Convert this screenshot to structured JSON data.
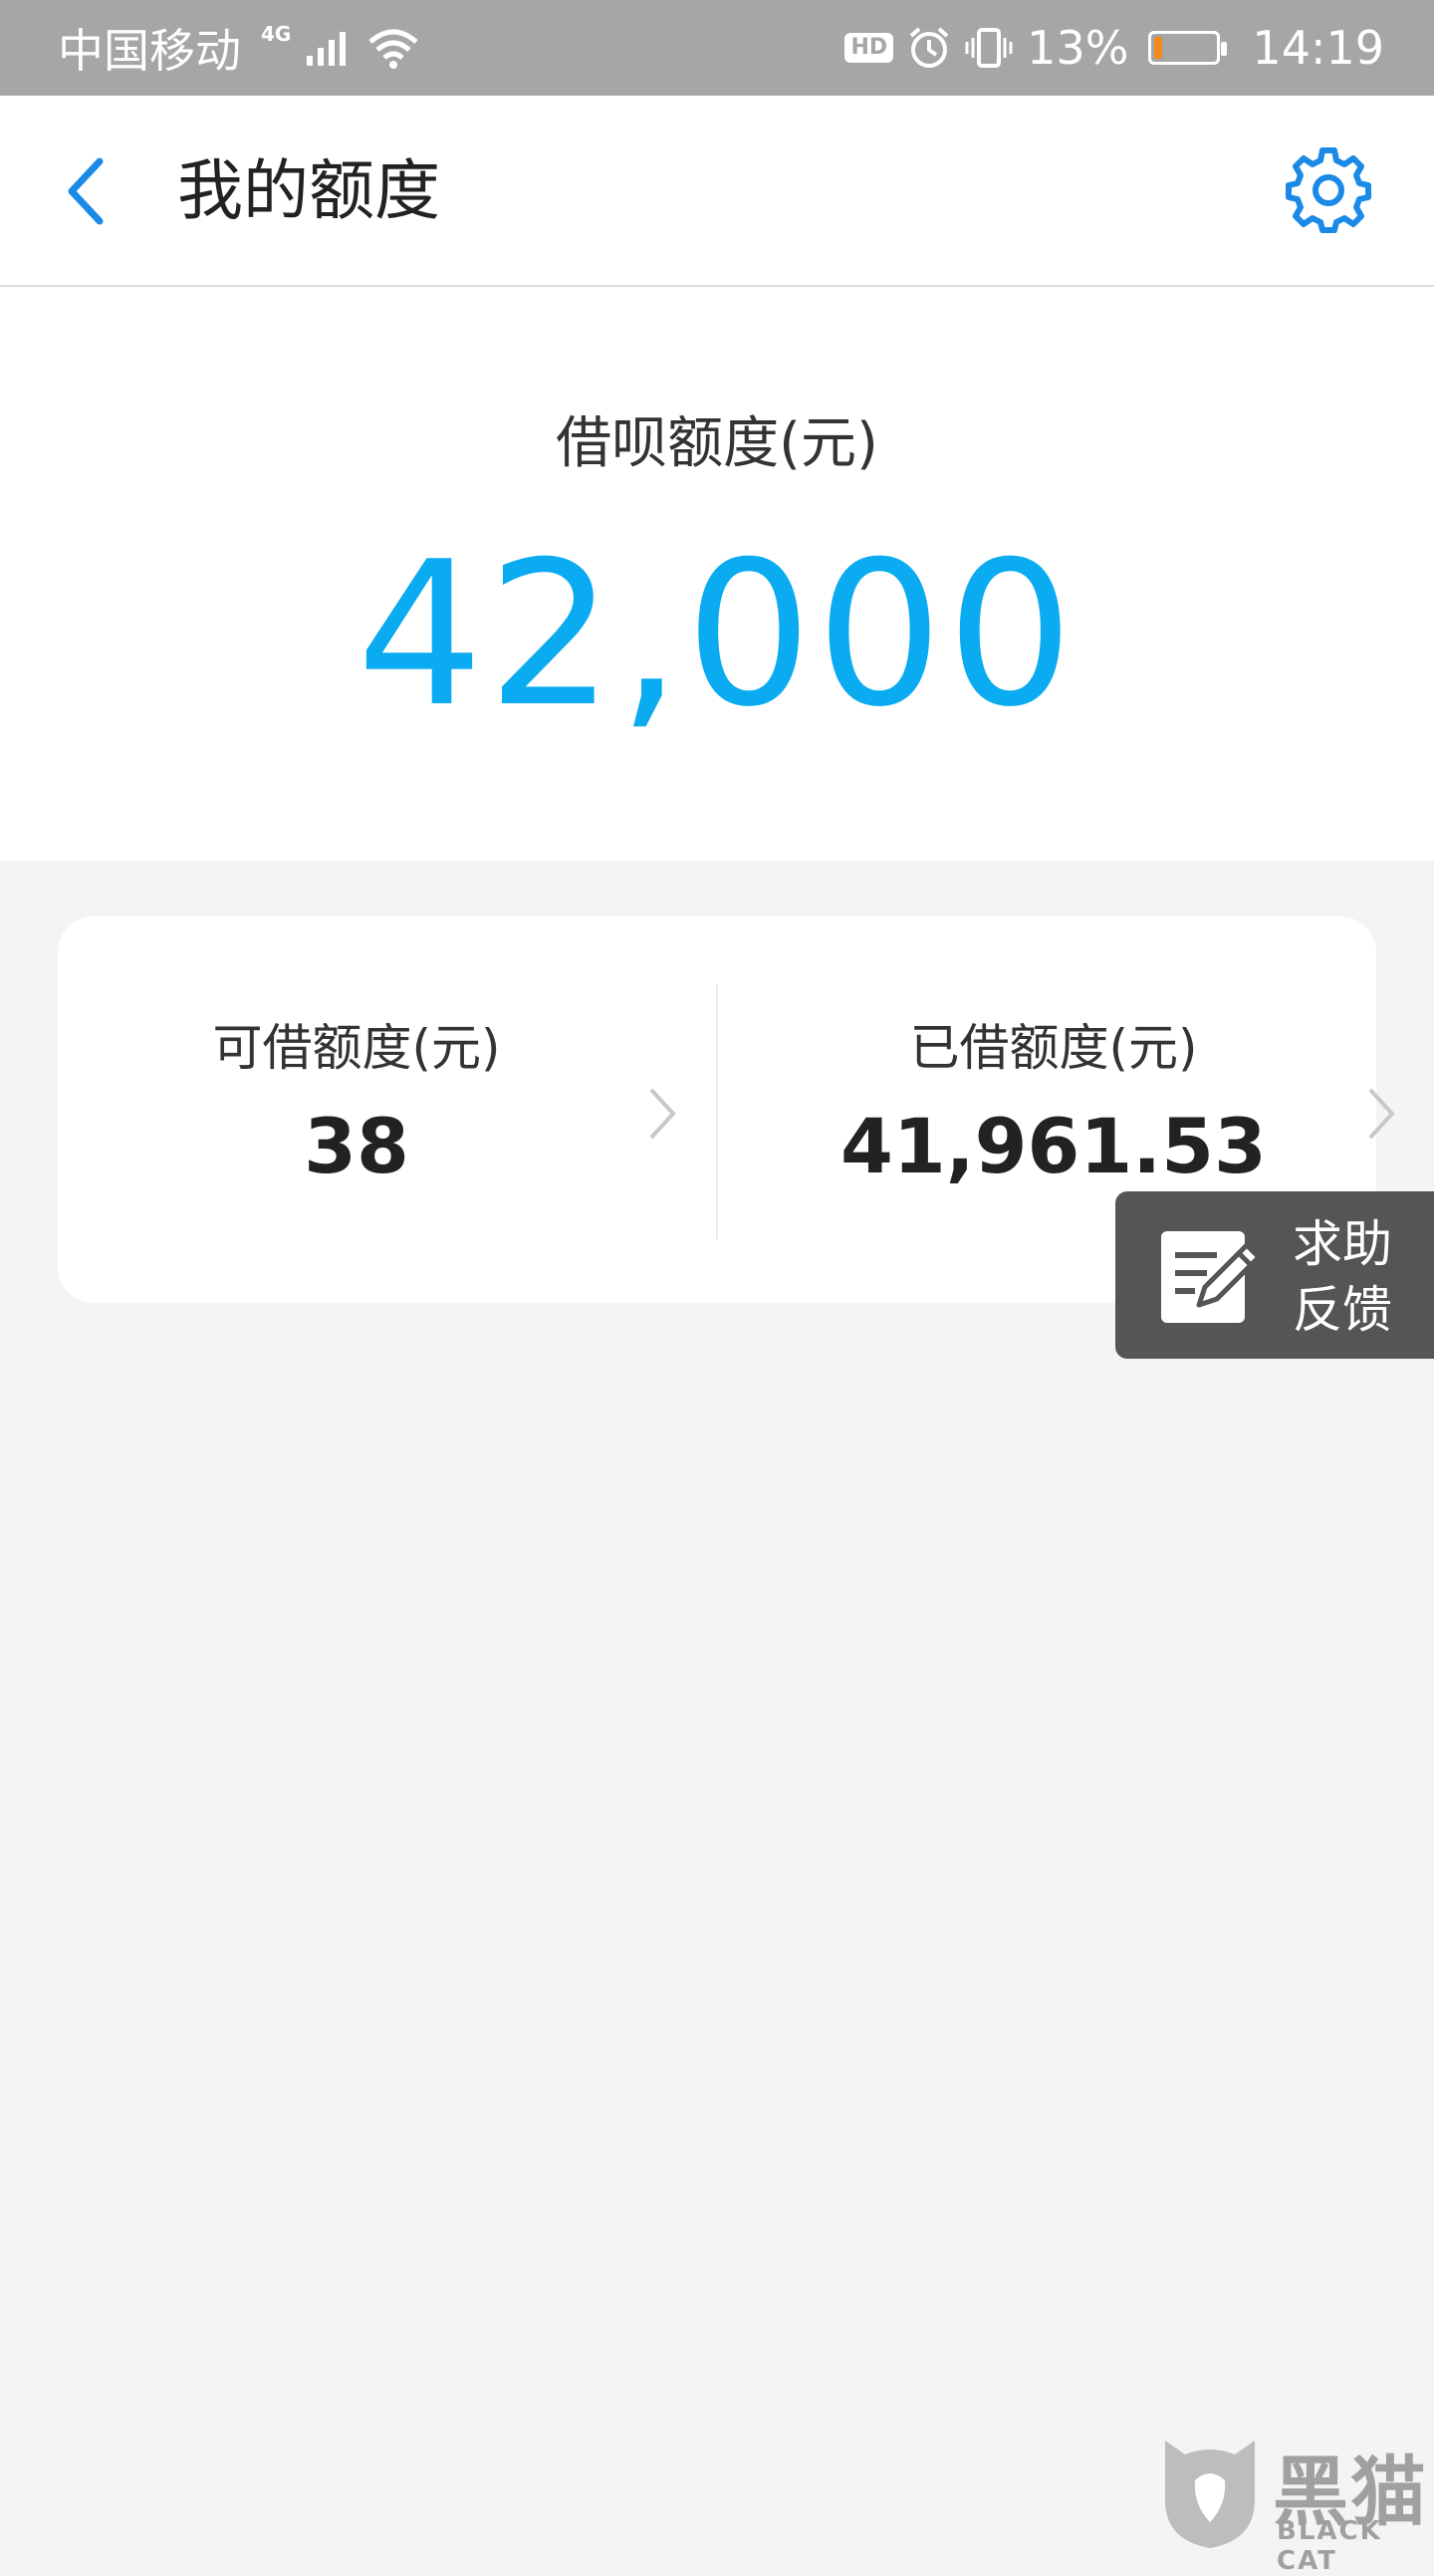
{
  "status_bar": {
    "carrier": "中国移动",
    "network": "4G",
    "battery_percent": "13%",
    "battery_level": 0.13,
    "time": "14:19"
  },
  "header": {
    "title": "我的额度"
  },
  "summary": {
    "label": "借呗额度(元)",
    "amount": "42,000"
  },
  "card": {
    "available_label": "可借额度(元)",
    "available_value": "38",
    "borrowed_label": "已借额度(元)",
    "borrowed_value": "41,961.53"
  },
  "feedback": {
    "line1": "求助",
    "line2": "反馈"
  },
  "watermark": {
    "cn": "黑猫",
    "en": "BLACK CAT"
  },
  "colors": {
    "accent": "#0aabf0",
    "icon_blue": "#1a8ae6",
    "status_bar_bg": "#a6a6a6",
    "battery_low": "#f08a1c"
  }
}
